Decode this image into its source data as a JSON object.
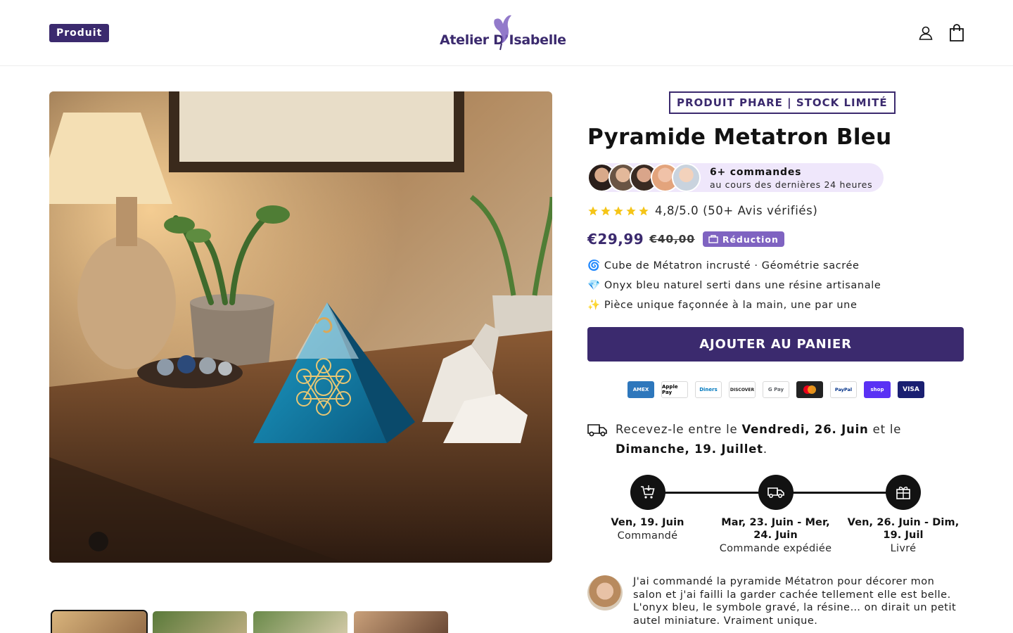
{
  "header": {
    "badge": "Produit",
    "logo_text": "Atelier D’Isabelle"
  },
  "product": {
    "tag": "PRODUIT PHARE | STOCK LIMITÉ",
    "title": "Pyramide Metatron Bleu",
    "orders_count": "6+ commandes",
    "orders_period": "au cours des dernières 24 heures",
    "rating_value": 4.8,
    "rating_text": "4,8/5.0 (50+ Avis vérifiés)",
    "price": "€29,99",
    "old_price": "€40,00",
    "discount_label": "Réduction",
    "features": [
      "🌀 Cube de Métatron incrusté · Géométrie sacrée",
      "💎 Onyx bleu naturel serti dans une résine artisanale",
      "✨ Pièce unique façonnée à la main, une par une"
    ],
    "add_to_cart": "AJOUTER AU PANIER"
  },
  "payments": [
    "AMEX",
    "Apple Pay",
    "Diners",
    "DISCOVER",
    "G Pay",
    "Mastercard",
    "PayPal",
    "shop",
    "VISA"
  ],
  "delivery": {
    "prefix": "Recevez-le entre le ",
    "start": "Vendredi, 26. Juin",
    "middle": " et le ",
    "end": "Dimanche, 19. Juillet",
    "suffix": "."
  },
  "timeline": [
    {
      "date": "Ven, 19. Juin",
      "label": "Commandé",
      "icon": "cart-icon"
    },
    {
      "date": "Mar, 23. Juin - Mer, 24. Juin",
      "label": "Commande expédiée",
      "icon": "truck-icon"
    },
    {
      "date": "Ven, 26. Juin - Dim, 19. Juil",
      "label": "Livré",
      "icon": "gift-icon"
    }
  ],
  "review": {
    "text": "J'ai commandé la pyramide Métatron pour décorer mon salon et j'ai failli la garder cachée tellement elle est belle. L'onyx bleu, le symbole gravé, la résine… on dirait un petit autel miniature. Vraiment unique."
  },
  "colors": {
    "brand": "#3b2a6e",
    "accent": "#7f63c1",
    "orders_bg": "#efe7fb",
    "star": "#f5c518"
  }
}
